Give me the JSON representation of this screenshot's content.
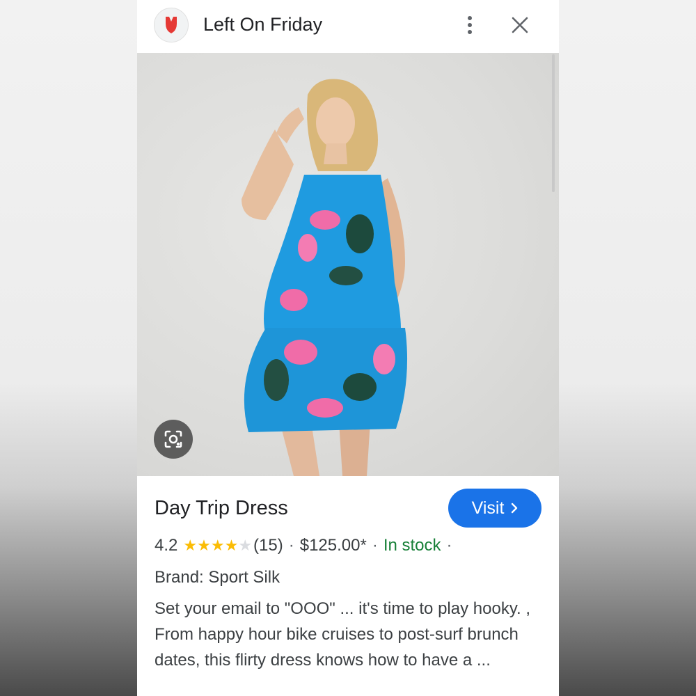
{
  "header": {
    "site_name": "Left On Friday",
    "logo_icon": "swimsuit-logo-icon",
    "more_icon": "more-vert-icon",
    "close_icon": "close-icon"
  },
  "image": {
    "description_icon": "product-photo",
    "lens_icon": "google-lens-icon"
  },
  "product": {
    "title": "Day Trip Dress",
    "visit_label": "Visit",
    "rating": "4.2",
    "rating_value": 4.2,
    "rating_max": 5,
    "review_count": "(15)",
    "price": "$125.00*",
    "availability": "In stock",
    "separator": "·",
    "brand_label": "Brand: ",
    "brand_value": "Sport Silk",
    "description": "Set your email to \"OOO\" ... it's time to play hooky. , From happy hour bike cruises to post-surf brunch dates, this flirty dress knows how to have a ..."
  },
  "colors": {
    "accent": "#1a73e8",
    "in_stock": "#188038",
    "star": "#fbbc04",
    "logo_red": "#e53935"
  }
}
